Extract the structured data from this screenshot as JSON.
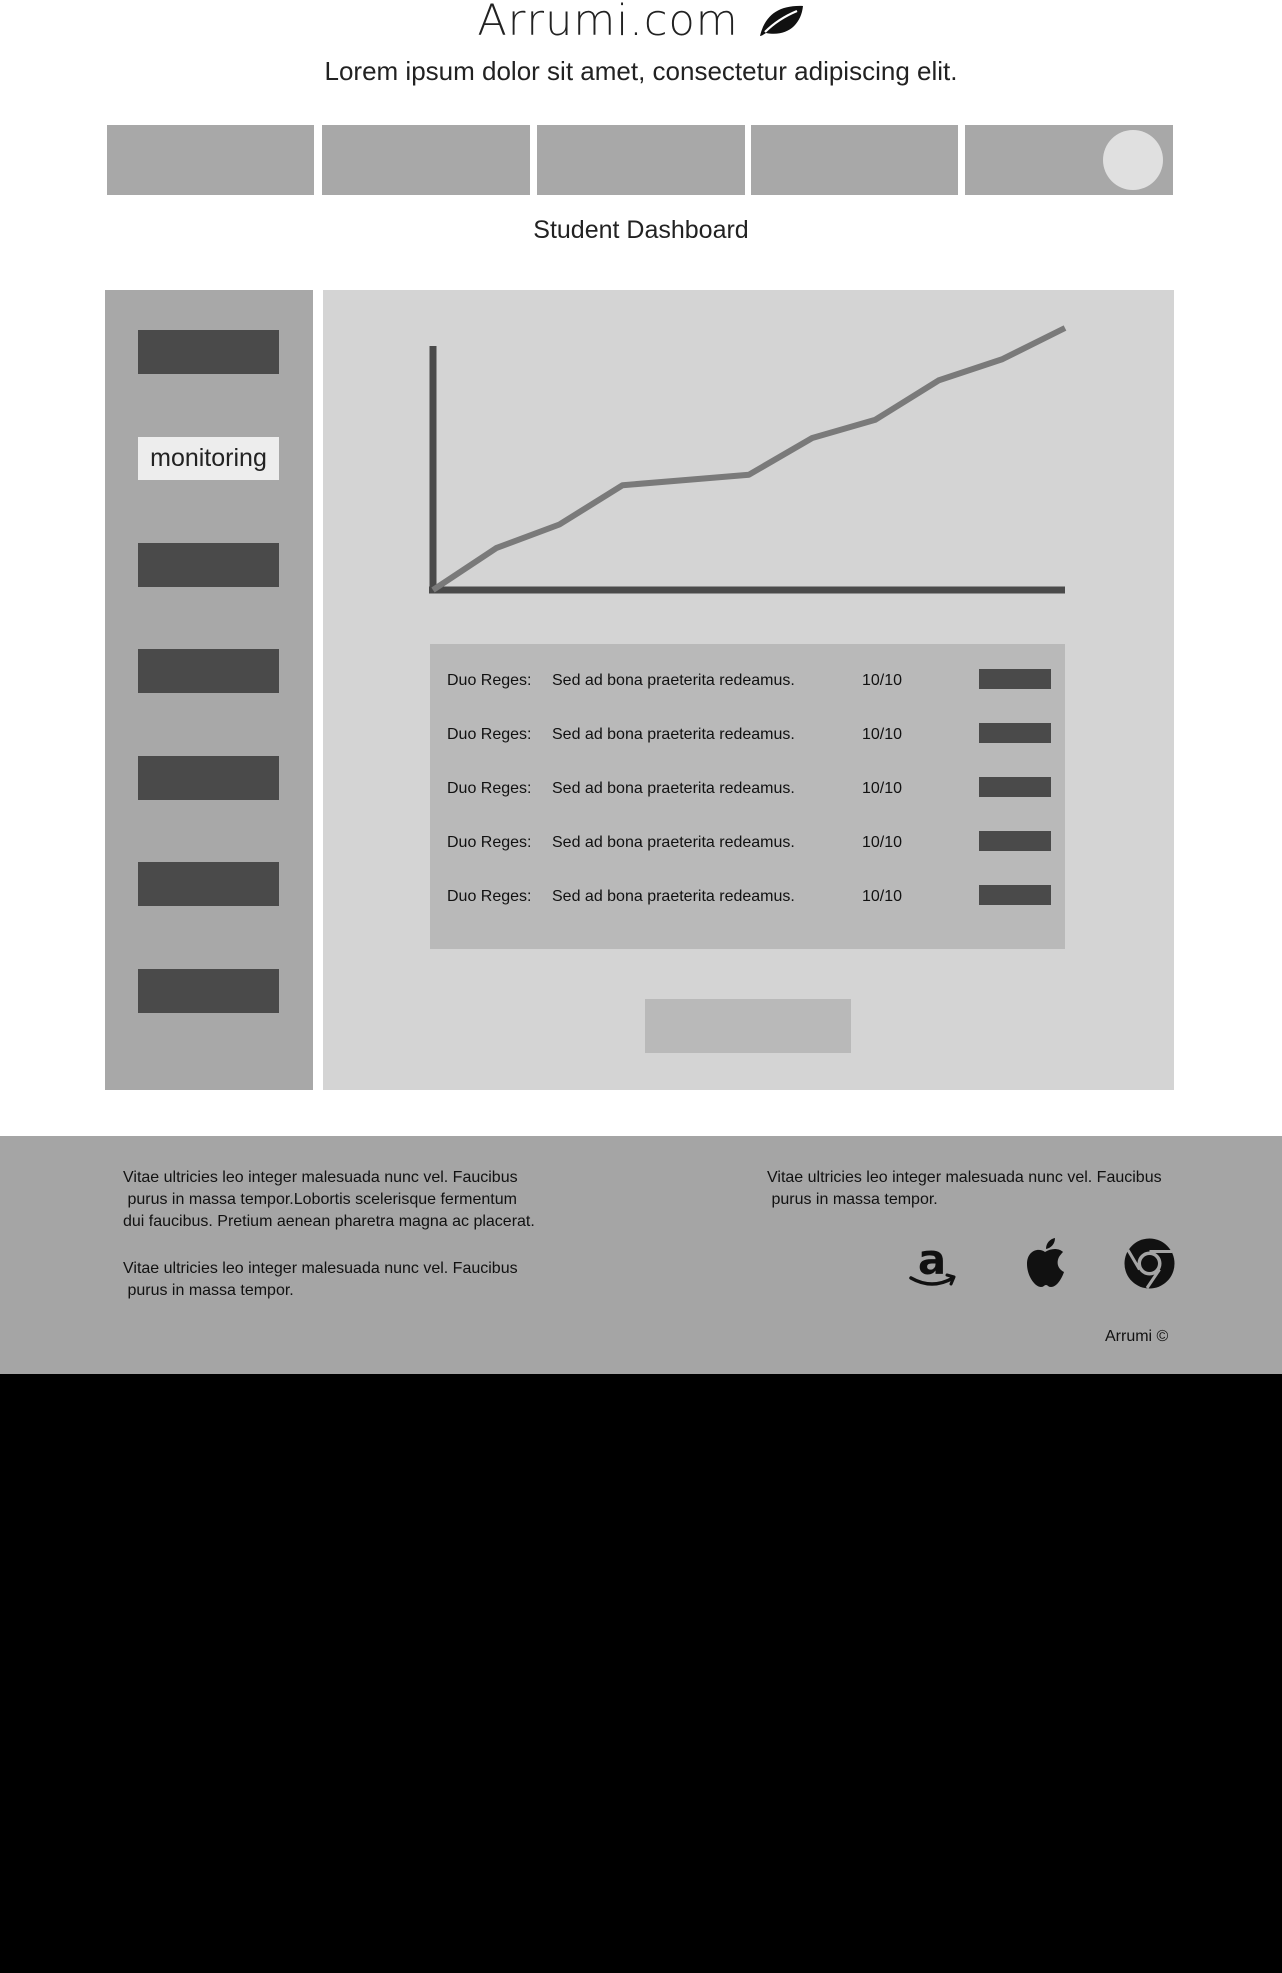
{
  "header": {
    "site_title": "Arrumi.com",
    "tagline": "Lorem ipsum dolor sit amet, consectetur adipiscing elit.",
    "logo_icon": "leaf-icon"
  },
  "nav": {
    "tab_count": 5,
    "avatar_icon": "avatar-circle"
  },
  "page_title": "Student Dashboard",
  "sidebar": {
    "active_label": "monitoring"
  },
  "chart_data": {
    "type": "line",
    "title": "",
    "xlabel": "",
    "ylabel": "",
    "grid": false,
    "series": [
      {
        "values": [
          0,
          16,
          25,
          40,
          42,
          44,
          58,
          65,
          80,
          88,
          100
        ]
      }
    ],
    "ylim": [
      0,
      100
    ]
  },
  "table": {
    "rows": [
      {
        "label": "Duo Reges:",
        "text": "Sed ad bona praeterita redeamus.",
        "score": "10/10"
      },
      {
        "label": "Duo Reges:",
        "text": "Sed ad bona praeterita redeamus.",
        "score": "10/10"
      },
      {
        "label": "Duo Reges:",
        "text": "Sed ad bona praeterita redeamus.",
        "score": "10/10"
      },
      {
        "label": "Duo Reges:",
        "text": "Sed ad bona praeterita redeamus.",
        "score": "10/10"
      },
      {
        "label": "Duo Reges:",
        "text": "Sed ad bona praeterita redeamus.",
        "score": "10/10"
      }
    ]
  },
  "footer": {
    "text_1": "Vitae ultricies leo integer malesuada nunc vel. Faucibus\n purus in massa tempor.Lobortis scelerisque fermentum\ndui faucibus. Pretium aenean pharetra magna ac placerat.",
    "text_2": "Vitae ultricies leo integer malesuada nunc vel. Faucibus\n purus in massa tempor.",
    "text_3": "Vitae ultricies leo integer malesuada nunc vel. Faucibus\n purus in massa tempor.",
    "icons": [
      "amazon-icon",
      "apple-icon",
      "chrome-icon"
    ],
    "copyright": "Arrumi ©"
  }
}
